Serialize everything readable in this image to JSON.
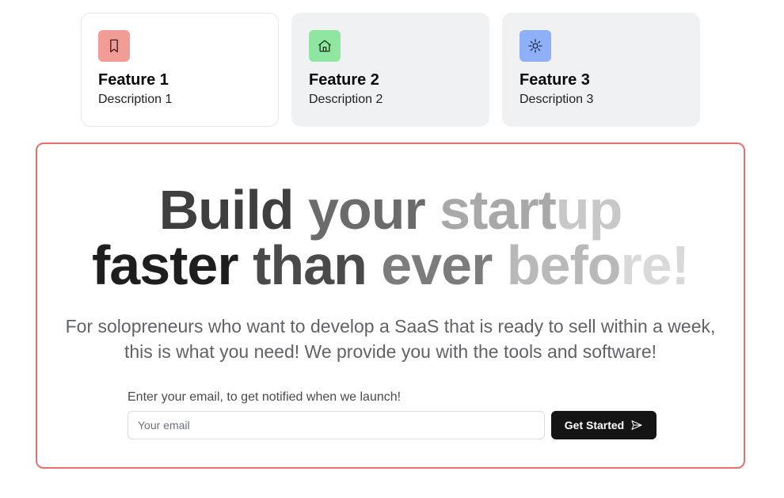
{
  "features": [
    {
      "title": "Feature 1",
      "description": "Description 1",
      "icon": "bookmark-icon",
      "icon_bg": "#f29c97",
      "active": true
    },
    {
      "title": "Feature 2",
      "description": "Description 2",
      "icon": "home-icon",
      "icon_bg": "#8fe6a1",
      "active": false
    },
    {
      "title": "Feature 3",
      "description": "Description 3",
      "icon": "sun-icon",
      "icon_bg": "#8fb0f7",
      "active": false
    }
  ],
  "hero": {
    "headline_line1": [
      "Build",
      "your",
      "start",
      "up"
    ],
    "headline_line2": [
      "faster",
      "than",
      "ever",
      "befo",
      "re!"
    ],
    "subtext": "For solopreneurs who want to develop a SaaS that is ready to sell within a week, this is what you need! We provide you with the tools and software!",
    "border_color": "#e8706c"
  },
  "signup": {
    "label": "Enter your email, to get notified when we launch!",
    "email_placeholder": "Your email",
    "email_value": "",
    "button_label": "Get Started",
    "button_icon": "send-icon"
  }
}
